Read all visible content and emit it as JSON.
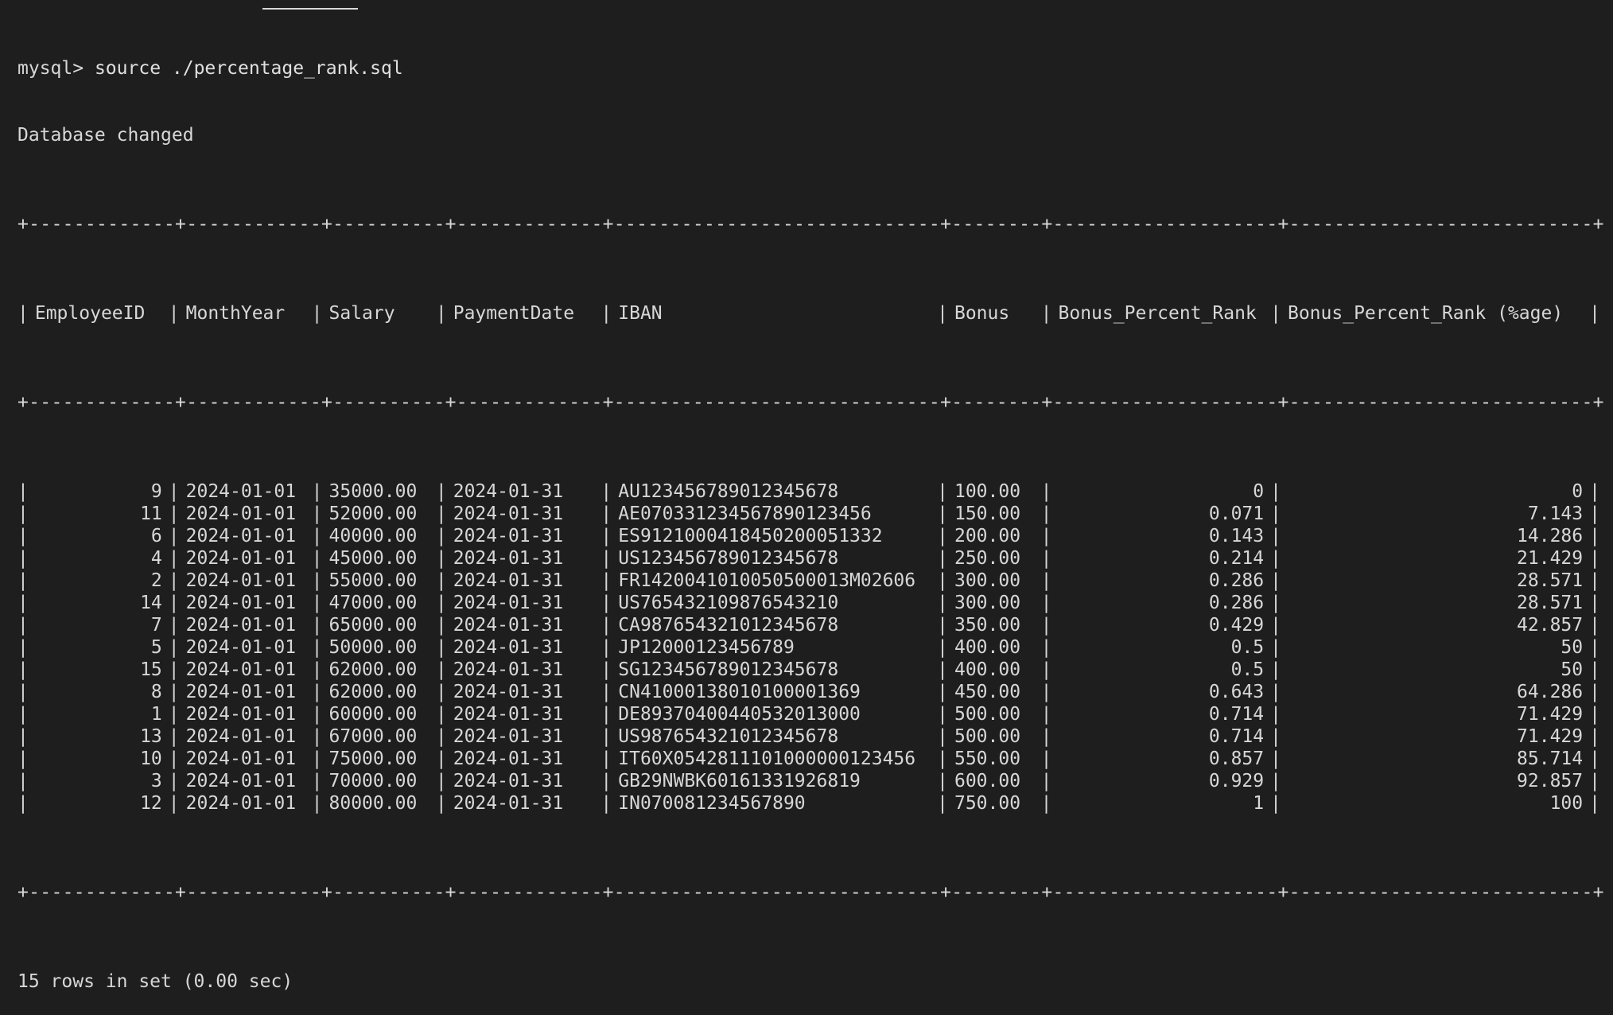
{
  "terminal": {
    "prompt": "mysql>",
    "command": "source ./percentage_rank.sql",
    "db_changed": "Database changed",
    "status": "15 rows in set (0.00 sec)"
  },
  "table": {
    "headers": [
      "EmployeeID",
      "MonthYear",
      "Salary",
      "PaymentDate",
      "IBAN",
      "Bonus",
      "Bonus_Percent_Rank",
      "Bonus_Percent_Rank (%age)"
    ],
    "rows": [
      [
        "9",
        "2024-01-01",
        "35000.00",
        "2024-01-31",
        "AU12345678901234567​8",
        "100.00",
        "0",
        "0"
      ],
      [
        "11",
        "2024-01-01",
        "52000.00",
        "2024-01-31",
        "AE070331234567890123456",
        "150.00",
        "0.071",
        "7.143"
      ],
      [
        "6",
        "2024-01-01",
        "40000.00",
        "2024-01-31",
        "ES9121000418450200051332",
        "200.00",
        "0.143",
        "14.286"
      ],
      [
        "4",
        "2024-01-01",
        "45000.00",
        "2024-01-31",
        "US12345678901234567​8",
        "250.00",
        "0.214",
        "21.429"
      ],
      [
        "2",
        "2024-01-01",
        "55000.00",
        "2024-01-31",
        "FR1420041010050500013M02606",
        "300.00",
        "0.286",
        "28.571"
      ],
      [
        "14",
        "2024-01-01",
        "47000.00",
        "2024-01-31",
        "US765432109876543210",
        "300.00",
        "0.286",
        "28.571"
      ],
      [
        "7",
        "2024-01-01",
        "65000.00",
        "2024-01-31",
        "CA987654321012345678",
        "350.00",
        "0.429",
        "42.857"
      ],
      [
        "5",
        "2024-01-01",
        "50000.00",
        "2024-01-31",
        "JP12000123456789",
        "400.00",
        "0.5",
        "50"
      ],
      [
        "15",
        "2024-01-01",
        "62000.00",
        "2024-01-31",
        "SG12345678901234567​8",
        "400.00",
        "0.5",
        "50"
      ],
      [
        "8",
        "2024-01-01",
        "62000.00",
        "2024-01-31",
        "CN4100013801010000136​9",
        "450.00",
        "0.643",
        "64.286"
      ],
      [
        "1",
        "2024-01-01",
        "60000.00",
        "2024-01-31",
        "DE89370400440532013000",
        "500.00",
        "0.714",
        "71.429"
      ],
      [
        "13",
        "2024-01-01",
        "67000.00",
        "2024-01-31",
        "US987654321012345678",
        "500.00",
        "0.714",
        "71.429"
      ],
      [
        "10",
        "2024-01-01",
        "75000.00",
        "2024-01-31",
        "IT60X0542811101000000123456",
        "550.00",
        "0.857",
        "85.714"
      ],
      [
        "3",
        "2024-01-01",
        "70000.00",
        "2024-01-31",
        "GB29NWBK60161331926819",
        "600.00",
        "0.929",
        "92.857"
      ],
      [
        "12",
        "2024-01-01",
        "80000.00",
        "2024-01-31",
        "IN070081234567890",
        "750.00",
        "1",
        "100"
      ]
    ]
  }
}
